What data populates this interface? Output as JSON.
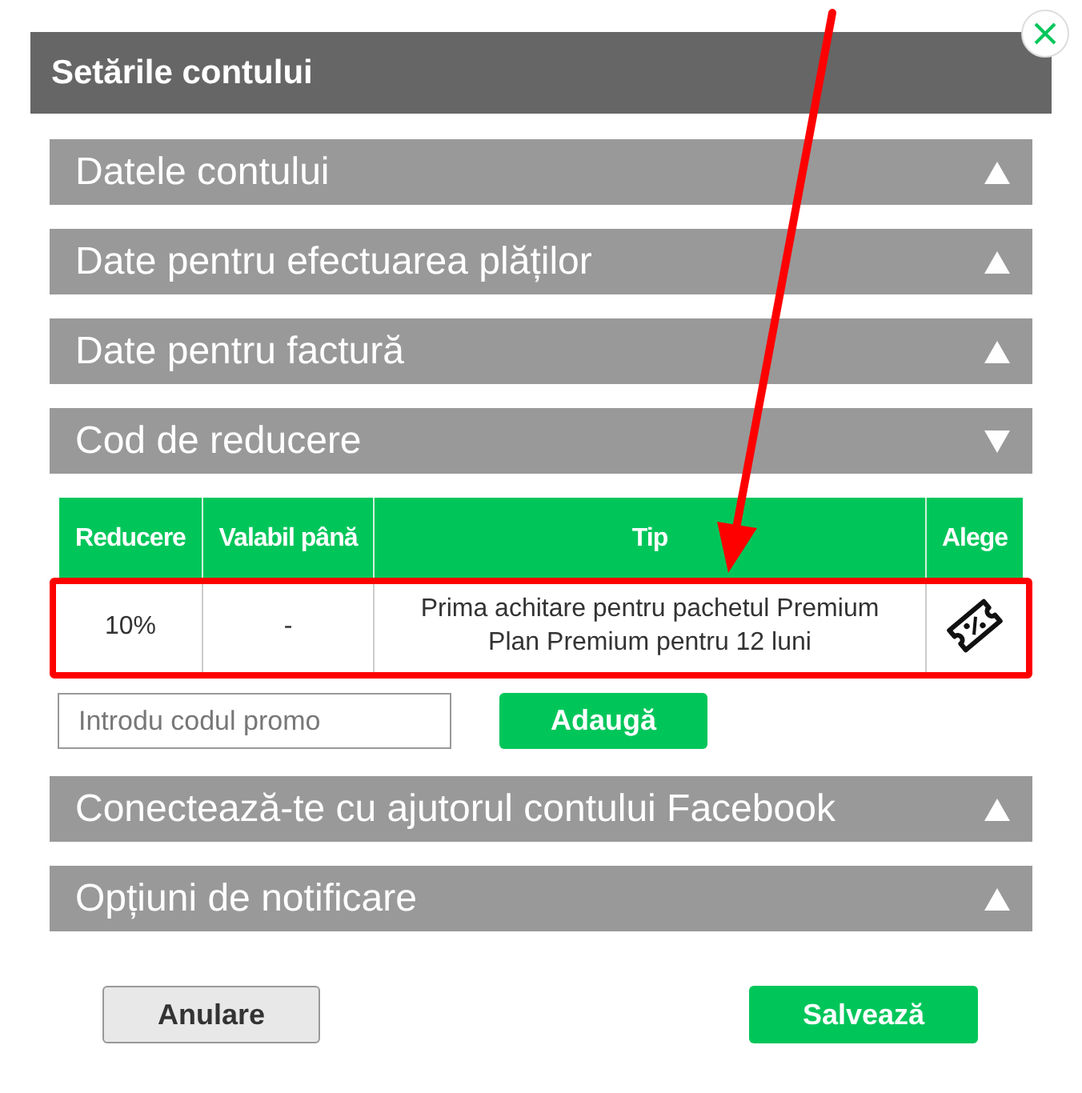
{
  "dialog": {
    "title": "Setările contului"
  },
  "sections_before": [
    {
      "title": "Datele contului",
      "expanded": false
    },
    {
      "title": "Date pentru efectuarea plăților",
      "expanded": false
    },
    {
      "title": "Date pentru factură",
      "expanded": false
    },
    {
      "title": "Cod de reducere",
      "expanded": true
    }
  ],
  "discount_table": {
    "columns": [
      "Reducere",
      "Valabil până",
      "Tip",
      "Alege"
    ],
    "rows": [
      {
        "discount": "10%",
        "valid_until": "-",
        "type_lines": [
          "Prima achitare pentru pachetul Premium",
          "Plan Premium pentru 12 luni"
        ],
        "highlighted": true
      }
    ]
  },
  "promo": {
    "placeholder": "Introdu codul promo",
    "button": "Adaugă"
  },
  "sections_after": [
    {
      "title": "Conectează-te cu ajutorul contului Facebook",
      "expanded": false
    },
    {
      "title": "Opțiuni de notificare",
      "expanded": false
    }
  ],
  "buttons": {
    "cancel": "Anulare",
    "save": "Salvează"
  }
}
